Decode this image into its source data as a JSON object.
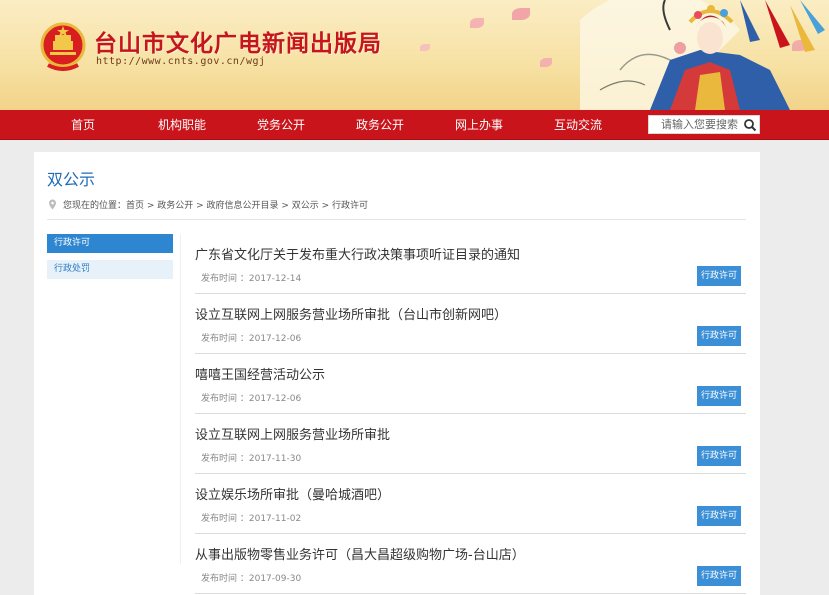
{
  "header": {
    "site_title": "台山市文化广电新闻出版局",
    "site_url": "http://www.cnts.gov.cn/wgj"
  },
  "nav": {
    "items": [
      "首页",
      "机构职能",
      "党务公开",
      "政务公开",
      "网上办事",
      "互动交流"
    ],
    "search_placeholder": "请输入您要搜索"
  },
  "page": {
    "title": "双公示",
    "breadcrumb": "您现在的位置：首页 > 政务公开 > 政府信息公开目录 > 双公示 > 行政许可"
  },
  "sidebar": {
    "items": [
      {
        "label": "行政许可",
        "active": true
      },
      {
        "label": "行政处罚",
        "active": false
      }
    ]
  },
  "articles": [
    {
      "title": "广东省文化厅关于发布重大行政决策事项听证目录的通知",
      "date": "发布时间 ：2017-12-14",
      "tag": "行政许可"
    },
    {
      "title": "设立互联网上网服务营业场所审批（台山市创新网吧）",
      "date": "发布时间 ：2017-12-06",
      "tag": "行政许可"
    },
    {
      "title": "嘻嘻王国经营活动公示",
      "date": "发布时间 ：2017-12-06",
      "tag": "行政许可"
    },
    {
      "title": "设立互联网上网服务营业场所审批",
      "date": "发布时间 ：2017-11-30",
      "tag": "行政许可"
    },
    {
      "title": "设立娱乐场所审批（曼哈城酒吧）",
      "date": "发布时间 ：2017-11-02",
      "tag": "行政许可"
    },
    {
      "title": "从事出版物零售业务许可（昌大昌超级购物广场-台山店）",
      "date": "发布时间 ：2017-09-30",
      "tag": "行政许可"
    }
  ],
  "colors": {
    "nav_red": "#c8141a",
    "title_red": "#c4161c",
    "accent_blue": "#2f86d0",
    "tag_blue": "#3a8fd6"
  },
  "icons": {
    "emblem": "national-emblem-icon",
    "search": "search-icon",
    "location": "location-pin-icon"
  }
}
